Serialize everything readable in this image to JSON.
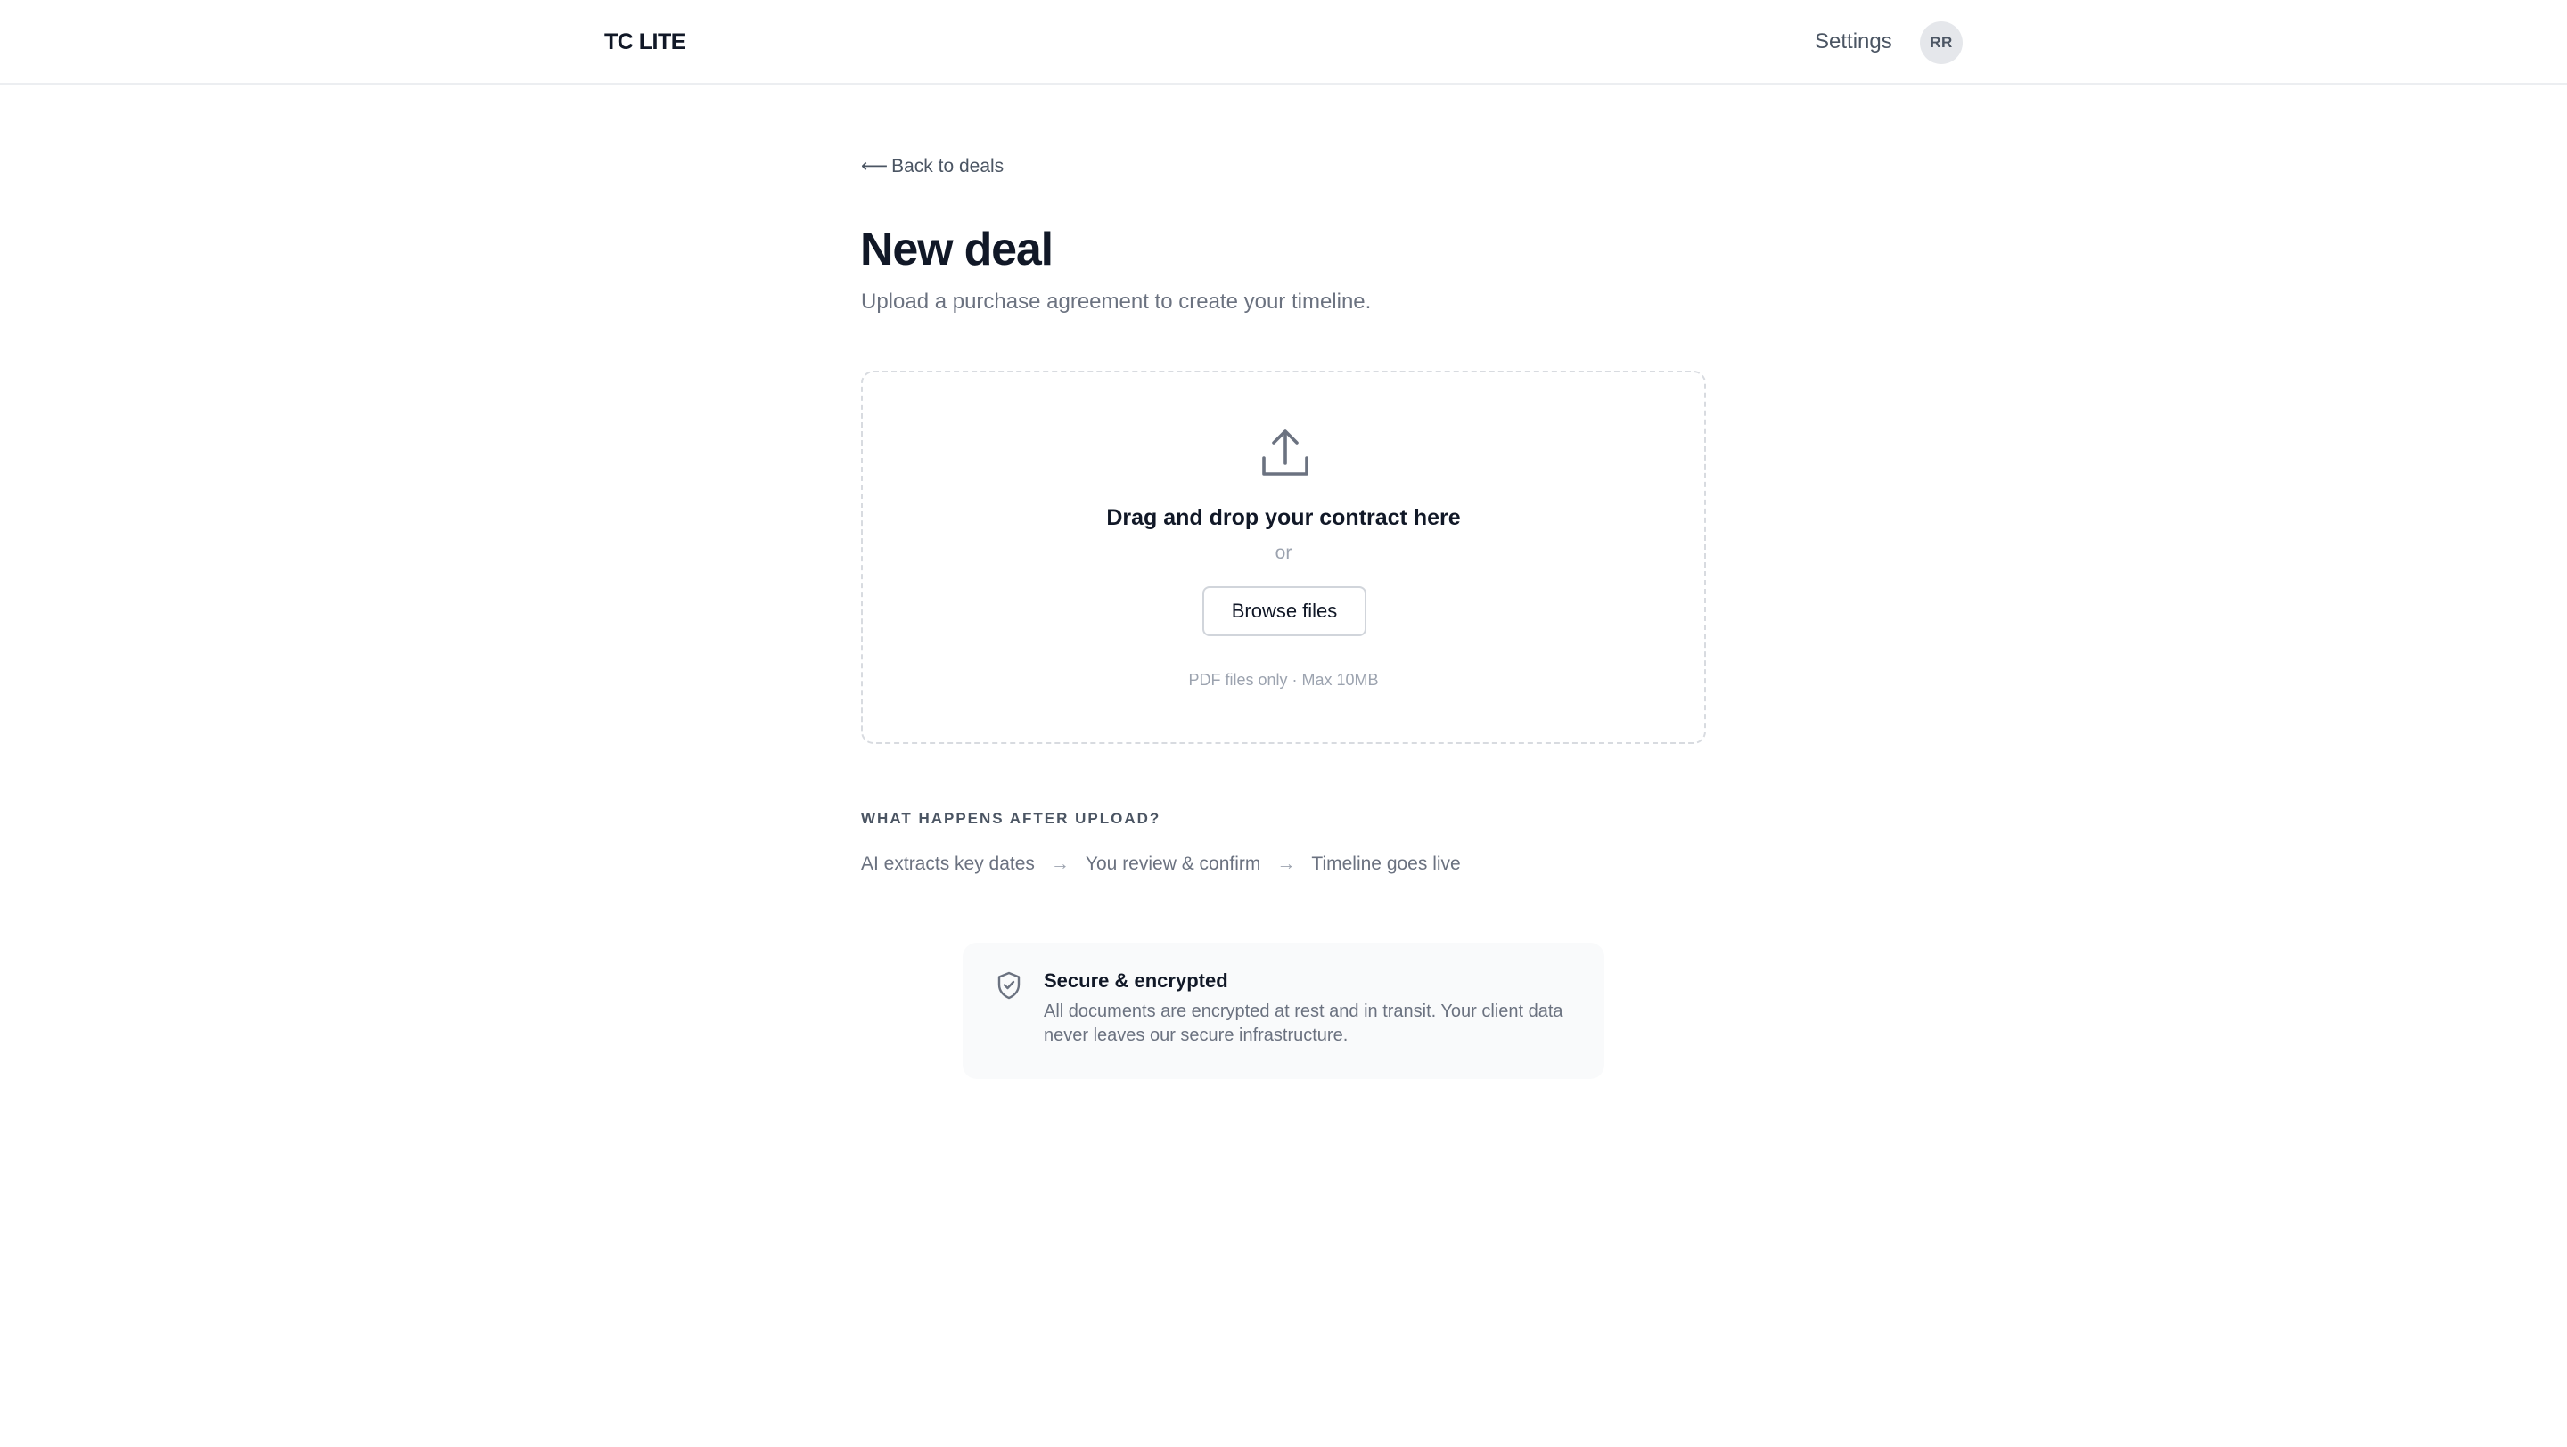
{
  "header": {
    "brand": "TC LITE",
    "settings_label": "Settings",
    "avatar_initials": "RR"
  },
  "main": {
    "back_arrow": "⟵",
    "back_label": "Back to deals",
    "title": "New deal",
    "subtitle": "Upload a purchase agreement to create your timeline."
  },
  "upload": {
    "icon": "upload-icon",
    "title": "Drag and drop your contract here",
    "or_text": "or",
    "browse_label": "Browse files",
    "hint": "PDF files only · Max 10MB"
  },
  "process": {
    "label": "WHAT HAPPENS AFTER UPLOAD?",
    "arrow": "→",
    "steps": [
      "AI extracts key dates",
      "You review & confirm",
      "Timeline goes live"
    ]
  },
  "security": {
    "icon": "shield-check-icon",
    "title": "Secure & encrypted",
    "body": "All documents are encrypted at rest and in transit. Your client data never leaves our secure infrastructure."
  },
  "colors": {
    "text_primary": "#111827",
    "text_secondary": "#6b7280",
    "border": "#d8dbe0",
    "card_bg": "#f9fafb",
    "avatar_bg": "#e5e7eb"
  }
}
